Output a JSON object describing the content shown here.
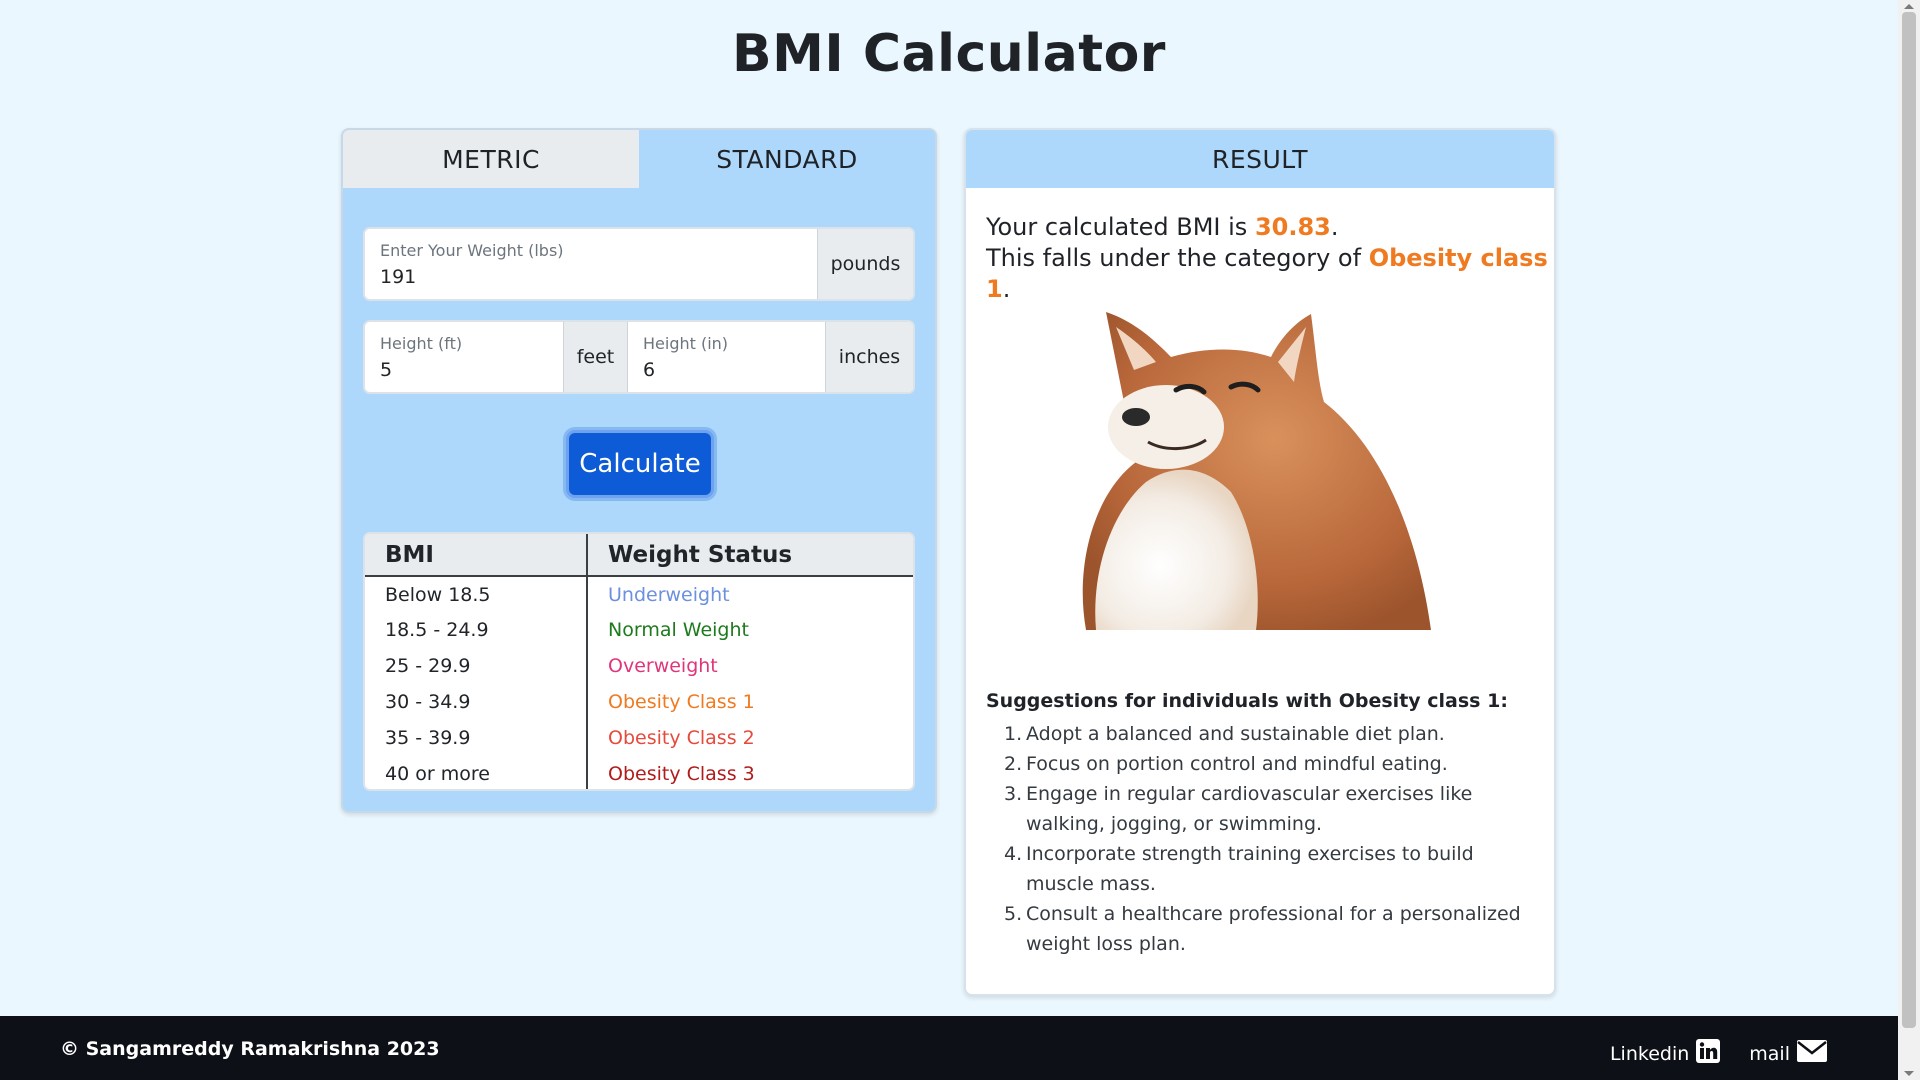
{
  "title": "BMI Calculator",
  "tabs": [
    {
      "label": "METRIC",
      "active": false
    },
    {
      "label": "STANDARD",
      "active": true
    }
  ],
  "weight": {
    "label": "Enter Your Weight (lbs)",
    "value": "191",
    "unit": "pounds"
  },
  "height_ft": {
    "label": "Height (ft)",
    "value": "5",
    "unit": "feet"
  },
  "height_in": {
    "label": "Height (in)",
    "value": "6",
    "unit": "inches"
  },
  "calculate_label": "Calculate",
  "table": {
    "headers": [
      "BMI",
      "Weight Status"
    ],
    "rows": [
      {
        "bmi": "Below 18.5",
        "status": "Underweight"
      },
      {
        "bmi": "18.5 - 24.9",
        "status": "Normal Weight"
      },
      {
        "bmi": "25 - 29.9",
        "status": "Overweight"
      },
      {
        "bmi": "30 - 34.9",
        "status": "Obesity Class 1"
      },
      {
        "bmi": "35 - 39.9",
        "status": "Obesity Class 2"
      },
      {
        "bmi": "40 or more",
        "status": "Obesity Class 3"
      }
    ]
  },
  "result": {
    "header": "RESULT",
    "line1_prefix": "Your calculated BMI is ",
    "bmi_value": "30.83",
    "line1_suffix": ".",
    "line2_prefix": "This falls under the category of ",
    "category": "Obesity class 1",
    "line2_suffix": ".",
    "suggestions_title": "Suggestions for individuals with Obesity class 1:",
    "suggestions": [
      "Adopt a balanced and sustainable diet plan.",
      "Focus on portion control and mindful eating.",
      "Engage in regular cardiovascular exercises like walking, jogging, or swimming.",
      "Incorporate strength training exercises to build muscle mass.",
      "Consult a healthcare professional for a personalized weight loss plan."
    ]
  },
  "footer": {
    "copyright": "© Sangamreddy Ramakrishna 2023",
    "linkedin": "Linkedin",
    "mail": "mail"
  },
  "colors": {
    "accent": "#f07a20",
    "primary_button": "#0d5bd6",
    "card_blue": "#aed8fb",
    "page_bg": "#ebf7fe"
  },
  "icons": [
    "linkedin-icon",
    "mail-icon"
  ]
}
